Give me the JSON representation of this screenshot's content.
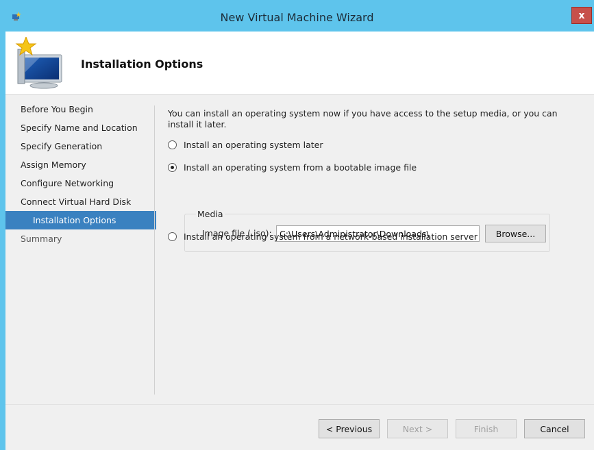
{
  "window": {
    "title": "New Virtual Machine Wizard",
    "close_glyph": "x",
    "accent_color": "#5ec4ec",
    "close_color": "#c7504a"
  },
  "header": {
    "title": "Installation Options",
    "icon": "monitor-star-icon"
  },
  "steps": [
    {
      "label": "Before You Begin",
      "state": "normal"
    },
    {
      "label": "Specify Name and Location",
      "state": "normal"
    },
    {
      "label": "Specify Generation",
      "state": "normal"
    },
    {
      "label": "Assign Memory",
      "state": "normal"
    },
    {
      "label": "Configure Networking",
      "state": "normal"
    },
    {
      "label": "Connect Virtual Hard Disk",
      "state": "normal"
    },
    {
      "label": "Installation Options",
      "state": "active"
    },
    {
      "label": "Summary",
      "state": "muted"
    }
  ],
  "content": {
    "intro": "You can install an operating system now if you have access to the setup media, or you can install it later.",
    "options": [
      {
        "label": "Install an operating system later",
        "checked": false
      },
      {
        "label": "Install an operating system from a bootable image file",
        "checked": true
      },
      {
        "label": "Install an operating system from a network-based installation server",
        "checked": false
      }
    ],
    "media": {
      "group_label": "Media",
      "image_label": "Image file (.iso):",
      "image_value": "C:\\Users\\Administrator\\Downloads\\",
      "browse_label": "Browse..."
    }
  },
  "footer": {
    "previous_label": "< Previous",
    "next_label": "Next >",
    "finish_label": "Finish",
    "cancel_label": "Cancel"
  }
}
